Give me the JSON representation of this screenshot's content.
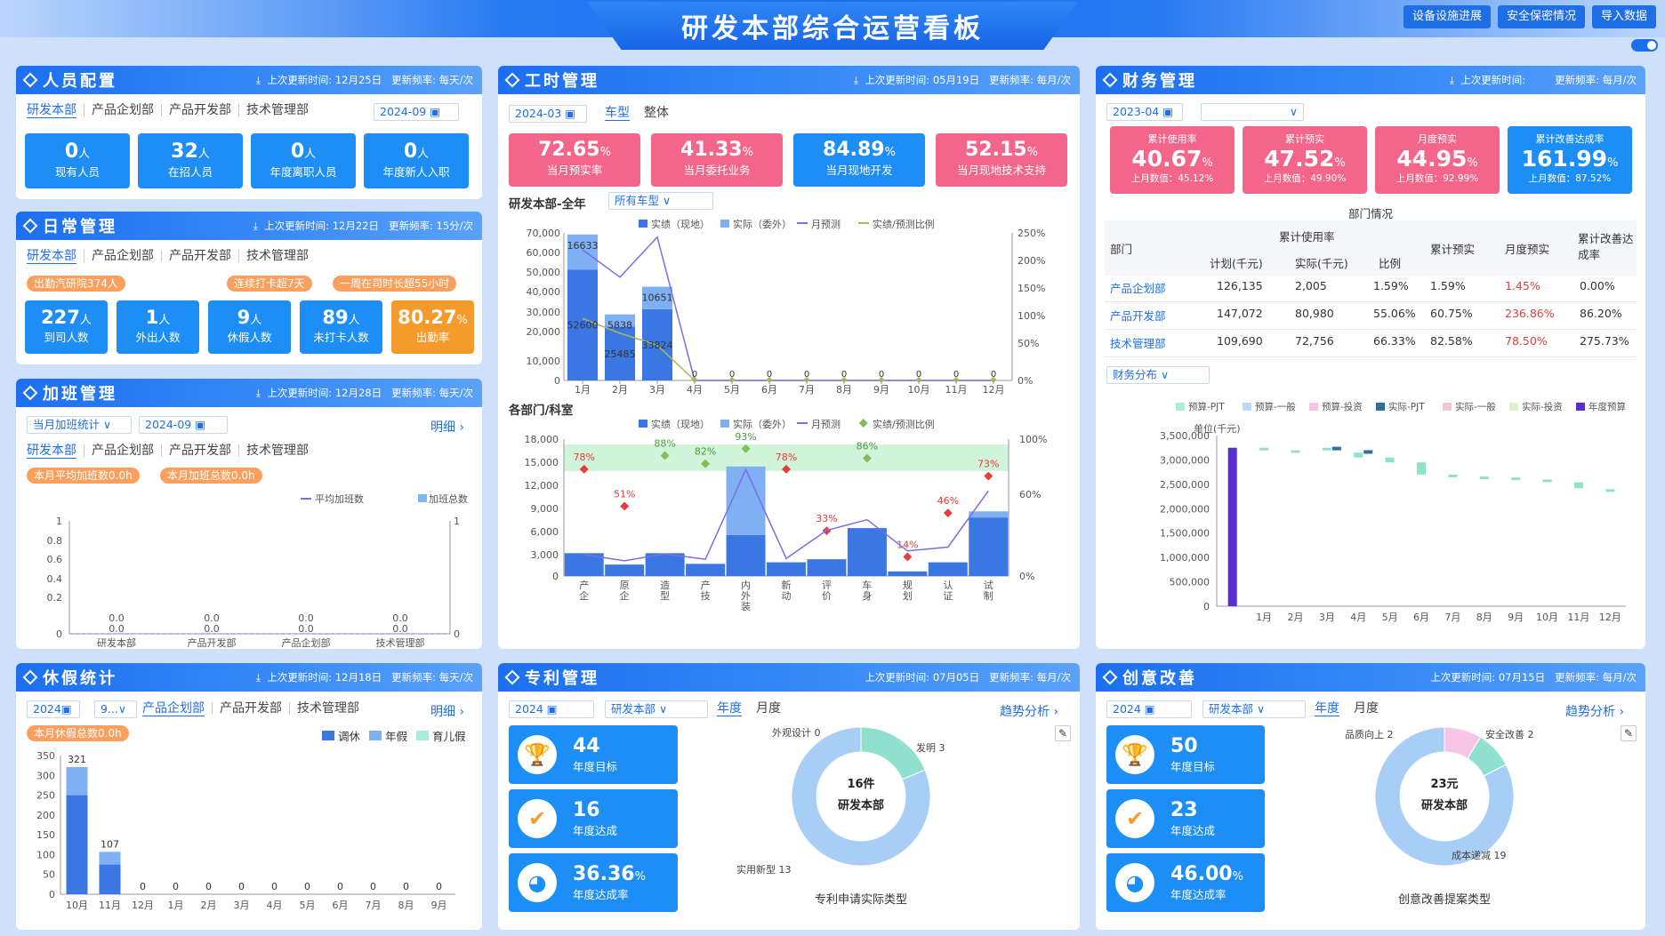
{
  "header": {
    "title": "研发本部综合运营看板",
    "buttons": [
      "设备设施进展",
      "安全保密情况",
      "导入数据"
    ]
  },
  "meta": {
    "update": "上次更新时间:",
    "freq": "更新频率:"
  },
  "p1": {
    "title": "人员配置",
    "time": "12月25日",
    "freq": "每天/次",
    "tabs": [
      "研发本部",
      "产品企划部",
      "产品开发部",
      "技术管理部"
    ],
    "date": "2024-09",
    "cards": [
      {
        "v": "0",
        "u": "人",
        "l": "现有人员"
      },
      {
        "v": "32",
        "u": "人",
        "l": "在招人员"
      },
      {
        "v": "0",
        "u": "人",
        "l": "年度离职人员"
      },
      {
        "v": "0",
        "u": "人",
        "l": "年度新人入职"
      }
    ]
  },
  "p2": {
    "title": "日常管理",
    "time": "12月22日",
    "freq": "15分/次",
    "tabs": [
      "研发本部",
      "产品企划部",
      "产品开发部",
      "技术管理部"
    ],
    "pills": [
      "出勤汽研院374人",
      "连续打卡超7天",
      "一周在司时长超55小时"
    ],
    "cards": [
      {
        "v": "227",
        "u": "人",
        "l": "到司人数"
      },
      {
        "v": "1",
        "u": "人",
        "l": "外出人数"
      },
      {
        "v": "9",
        "u": "人",
        "l": "休假人数"
      },
      {
        "v": "89",
        "u": "人",
        "l": "未打卡人数"
      },
      {
        "v": "80.27",
        "u": "%",
        "l": "出勤率"
      }
    ]
  },
  "p3": {
    "title": "加班管理",
    "time": "12月28日",
    "freq": "每天/次",
    "select": "当月加班统计",
    "date": "2024-09",
    "detail": "明细",
    "tabs": [
      "研发本部",
      "产品企划部",
      "产品开发部",
      "技术管理部"
    ],
    "pills": [
      "本月平均加班数0.0h",
      "本月加班总数0.0h"
    ],
    "chart_data": {
      "type": "bar",
      "series": [
        {
          "name": "平均加班数",
          "values": [
            0,
            0,
            0,
            0
          ]
        },
        {
          "name": "加班总数",
          "values": [
            0,
            0,
            0,
            0
          ]
        }
      ],
      "categories": [
        "研发本部",
        "产品开发部",
        "产品企划部",
        "技术管理部"
      ],
      "yticks": [
        "1",
        "0.8",
        "0.6",
        "0.4",
        "0.2",
        "0"
      ],
      "yticks_r": [
        "1",
        "0"
      ],
      "labels": [
        "0.0",
        "0.0",
        "0.0",
        "0.0",
        "0.0",
        "0.0",
        "0.0",
        "0.0"
      ]
    }
  },
  "p4": {
    "title": "工时管理",
    "time": "05月19日",
    "freq": "每月/次",
    "date": "2024-03",
    "tabs": [
      "车型",
      "整体"
    ],
    "cards": [
      {
        "v": "72.65",
        "u": "%",
        "l": "当月预实率"
      },
      {
        "v": "41.33",
        "u": "%",
        "l": "当月委托业务"
      },
      {
        "v": "84.89",
        "u": "%",
        "l": "当月现地开发"
      },
      {
        "v": "52.15",
        "u": "%",
        "l": "当月现地技术支持"
      }
    ],
    "chart1_title": "研发本部-全年",
    "chart1_select": "所有车型",
    "chart2_title": "各部门/科室",
    "legend": [
      "实绩（现地）",
      "实际（委外）",
      "月预测",
      "实绩/预测比例"
    ],
    "chart_data": [
      {
        "type": "bar",
        "categories": [
          "1月",
          "2月",
          "3月",
          "4月",
          "5月",
          "6月",
          "7月",
          "8月",
          "9月",
          "10月",
          "11月",
          "12月"
        ],
        "series": [
          {
            "name": "实绩（现地）",
            "values": [
              52600,
              25485,
              33824,
              0,
              0,
              0,
              0,
              0,
              0,
              0,
              0,
              0
            ]
          },
          {
            "name": "实际（委外）",
            "values": [
              16633,
              5838,
              10651,
              0,
              0,
              0,
              0,
              0,
              0,
              0,
              0,
              0
            ]
          },
          {
            "name": "月预测",
            "values": [
              62000,
              49000,
              68000,
              0,
              0,
              0,
              0,
              0,
              0,
              0,
              0,
              0
            ]
          },
          {
            "name": "实绩/预测比例",
            "values": [
              105,
              80,
              60,
              0,
              0,
              0,
              0,
              0,
              0,
              0,
              0,
              0
            ]
          }
        ],
        "yticks": [
          "70,000",
          "60,000",
          "50,000",
          "40,000",
          "30,000",
          "20,000",
          "10,000",
          "0"
        ],
        "yticks_r": [
          "250%",
          "200%",
          "150%",
          "100%",
          "50%",
          "0%"
        ],
        "labels": [
          "16633",
          "52600",
          "5838",
          "25485",
          "10651",
          "33824",
          "0",
          "0",
          "0",
          "0",
          "0",
          "0",
          "0",
          "0",
          "0",
          "0",
          "0",
          "0",
          "0",
          "0",
          "0",
          "0",
          "0",
          "0",
          "0",
          "0",
          "0"
        ]
      },
      {
        "type": "bar",
        "categories": [
          "产企",
          "原企",
          "造型",
          "产技",
          "内外装",
          "新动",
          "评价",
          "车身",
          "规划",
          "认证",
          "试制"
        ],
        "series": [
          {
            "name": "实绩（现地）",
            "values": [
              3000,
              1500,
              3000,
              1600,
              5400,
              1800,
              2200,
              6300,
              600,
              1800,
              7700
            ]
          },
          {
            "name": "实际（委外）",
            "values": [
              0,
              0,
              0,
              0,
              9000,
              0,
              0,
              0,
              0,
              0,
              800
            ]
          },
          {
            "name": "月预测",
            "values": [
              2800,
              2000,
              2900,
              2200,
              14000,
              2300,
              6000,
              7400,
              3300,
              3800,
              11200
            ]
          },
          {
            "name": "实绩/预测比例",
            "values": [
              78,
              51,
              88,
              82,
              93,
              78,
              33,
              86,
              14,
              46,
              73
            ]
          }
        ],
        "yticks": [
          "18,000",
          "15,000",
          "12,000",
          "9,000",
          "6,000",
          "3,000",
          "0"
        ],
        "yticks_r": [
          "100%",
          "60%",
          "0%"
        ],
        "ratio_labels": [
          "78%",
          "51%",
          "88%",
          "82%",
          "93%",
          "78%",
          "33%",
          "86%",
          "14%",
          "46%",
          "73%"
        ]
      }
    ]
  },
  "p5": {
    "title": "财务管理",
    "time": "",
    "freq": "每月/次",
    "date": "2023-04",
    "cards": [
      {
        "t": "累计使用率",
        "v": "40.67",
        "u": "%",
        "s": "上月数值：45.12%"
      },
      {
        "t": "累计预实",
        "v": "47.52",
        "u": "%",
        "s": "上月数值：49.90%"
      },
      {
        "t": "月度预实",
        "v": "44.95",
        "u": "%",
        "s": "上月数值：92.99%"
      },
      {
        "t": "累计改善达成率",
        "v": "161.99",
        "u": "%",
        "s": "上月数值：87.52%"
      }
    ],
    "table": {
      "title": "部门情况",
      "h1": [
        "部门",
        "累计使用率",
        "累计预实",
        "月度预实",
        "累计改善达成率"
      ],
      "h2": [
        "计划(千元)",
        "实际(千元)",
        "比例"
      ],
      "rows": [
        [
          "产品企划部",
          "126,135",
          "2,005",
          "1.59%",
          "1.59%",
          "1.45%",
          "0.00%"
        ],
        [
          "产品开发部",
          "147,072",
          "80,980",
          "55.06%",
          "60.75%",
          "236.86%",
          "86.20%"
        ],
        [
          "技术管理部",
          "109,690",
          "72,756",
          "66.33%",
          "82.58%",
          "78.50%",
          "275.73%"
        ]
      ]
    },
    "select": "财务分布",
    "legend": [
      "预算-PJT",
      "预算-一般",
      "预算-投资",
      "实际-PJT",
      "实际-一般",
      "实际-投资",
      "年度预算"
    ],
    "unit": "单位(千元)",
    "chart_data": {
      "type": "bar",
      "categories": [
        "1月",
        "2月",
        "3月",
        "4月",
        "5月",
        "6月",
        "7月",
        "8月",
        "9月",
        "10月",
        "11月",
        "12月"
      ],
      "yticks": [
        "3,500,000",
        "3,000,000",
        "2,500,000",
        "2,000,000",
        "1,500,000",
        "1,000,000",
        "500,000",
        "0"
      ],
      "annual_budget": 3250000
    }
  },
  "p6": {
    "title": "休假统计",
    "time": "12月18日",
    "freq": "每天/次",
    "date": "2024",
    "sel": "9...",
    "tabs": [
      "产品企划部",
      "产品开发部",
      "技术管理部"
    ],
    "detail": "明细",
    "pill": "本月休假总数0.0h",
    "legend": [
      "调休",
      "年假",
      "育儿假"
    ],
    "chart_data": {
      "type": "bar",
      "categories": [
        "10月",
        "11月",
        "12月",
        "1月",
        "2月",
        "3月",
        "4月",
        "5月",
        "6月",
        "7月",
        "8月",
        "9月"
      ],
      "values": [
        321,
        107,
        0,
        0,
        0,
        0,
        0,
        0,
        0,
        0,
        0,
        0
      ],
      "yticks": [
        "350",
        "300",
        "250",
        "200",
        "150",
        "100",
        "50",
        "0"
      ]
    }
  },
  "p7": {
    "title": "专利管理",
    "time": "07月05日",
    "freq": "每月/次",
    "date": "2024",
    "sel": "研发本部",
    "tabs": [
      "年度",
      "月度"
    ],
    "trend": "趋势分析",
    "cards": [
      {
        "v": "44",
        "u": "",
        "l": "年度目标"
      },
      {
        "v": "16",
        "u": "",
        "l": "年度达成"
      },
      {
        "v": "36.36",
        "u": "%",
        "l": "年度达成率"
      }
    ],
    "donut": {
      "center1": "16件",
      "center2": "研发本部",
      "caption": "专利申请实际类型",
      "labels": [
        "外观设计 0",
        "发明 3",
        "实用新型 13"
      ]
    },
    "chart_data": {
      "type": "pie",
      "categories": [
        "外观设计",
        "发明",
        "实用新型"
      ],
      "values": [
        0,
        3,
        13
      ]
    }
  },
  "p8": {
    "title": "创意改善",
    "time": "07月15日",
    "freq": "每月/次",
    "date": "2024",
    "sel": "研发本部",
    "tabs": [
      "年度",
      "月度"
    ],
    "trend": "趋势分析",
    "cards": [
      {
        "v": "50",
        "u": "",
        "l": "年度目标"
      },
      {
        "v": "23",
        "u": "",
        "l": "年度达成"
      },
      {
        "v": "46.00",
        "u": "%",
        "l": "年度达成率"
      }
    ],
    "donut": {
      "center1": "23元",
      "center2": "研发本部",
      "caption": "创意改善提案类型",
      "labels": [
        "品质向上 2",
        "安全改善 2",
        "成本递减 19"
      ]
    },
    "chart_data": {
      "type": "pie",
      "categories": [
        "品质向上",
        "安全改善",
        "成本递减"
      ],
      "values": [
        2,
        2,
        19
      ]
    }
  }
}
